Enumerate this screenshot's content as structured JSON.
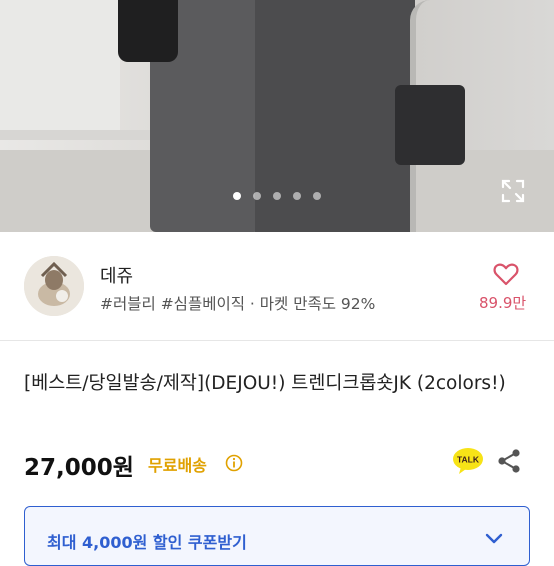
{
  "gallery": {
    "slide_count": 5,
    "active_index": 0,
    "icons": {
      "expand": "expand-icon"
    }
  },
  "seller": {
    "name": "데쥬",
    "tags": "#러블리 #심플베이직 · 마켓 만족도 92%",
    "likes": "89.9만",
    "icons": {
      "like": "heart-icon",
      "avatar": "avatar"
    }
  },
  "product": {
    "title": "[베스트/당일발송/제작](DEJOU!) 트렌디크롭숏JK (2colors!)",
    "price": "27,000원",
    "shipping": "무료배송",
    "icons": {
      "info": "info-icon",
      "talk": "kakaotalk-icon",
      "share": "share-icon"
    },
    "talk_label": "TALK"
  },
  "coupon": {
    "label": "최대 4,000원 할인 쿠폰받기",
    "icon": "chevron-down-icon"
  },
  "colors": {
    "accent_blue": "#2f5fd0",
    "shipping_yellow": "#e0a100",
    "like_pink": "#d9536a",
    "kakao_yellow": "#f7e317"
  }
}
